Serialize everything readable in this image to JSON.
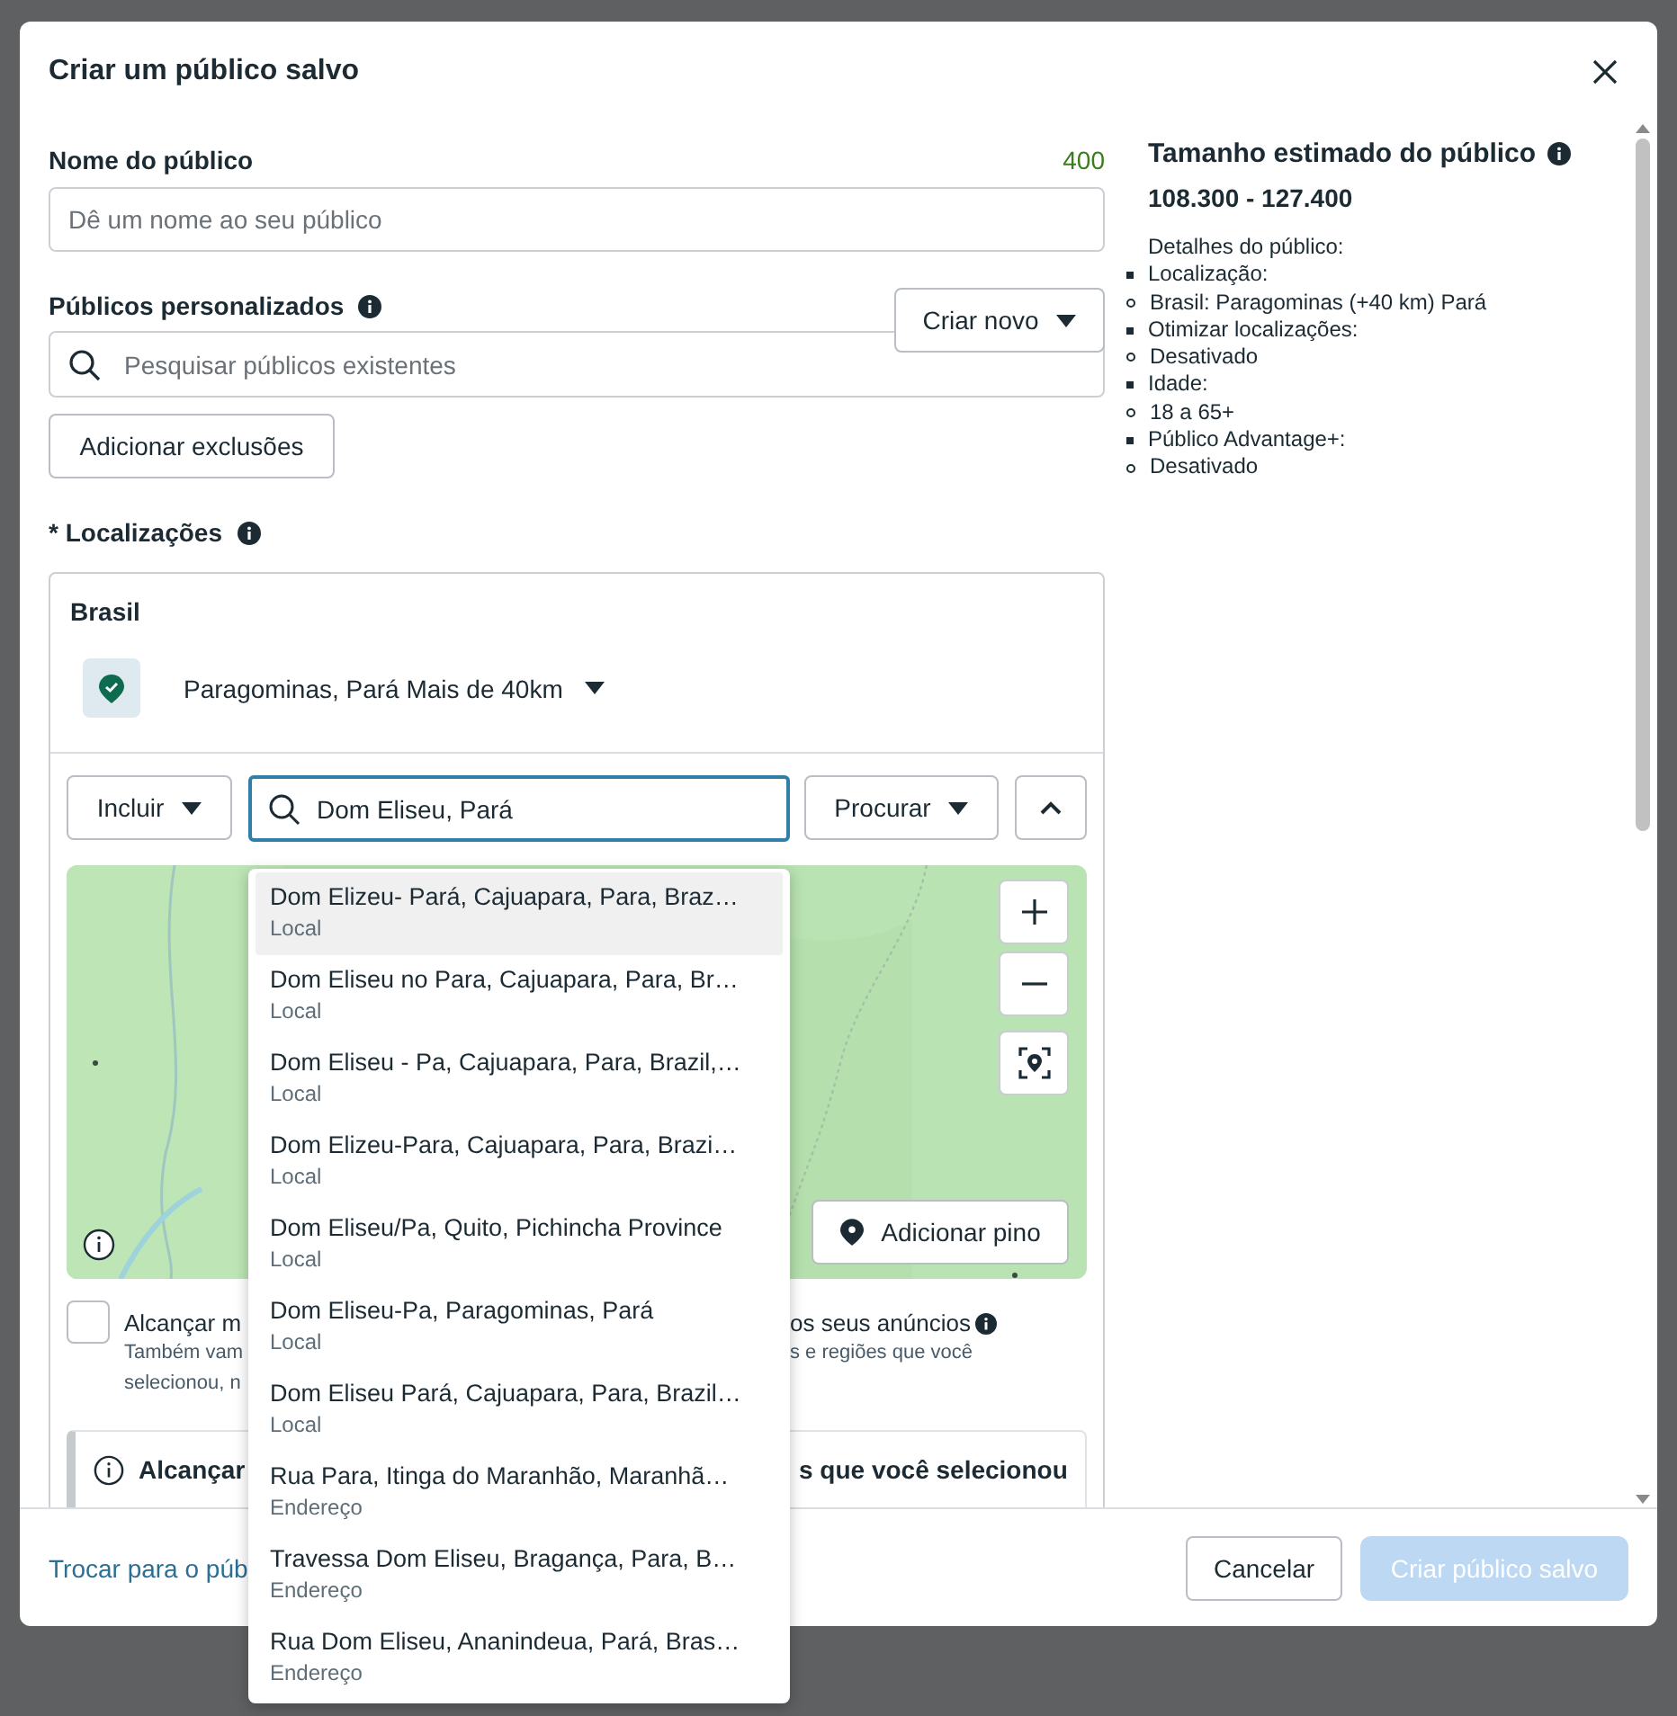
{
  "dialog": {
    "title": "Criar um público salvo"
  },
  "audience_name": {
    "label": "Nome do público",
    "char_count": "400",
    "placeholder": "Dê um nome ao seu público"
  },
  "custom_audiences": {
    "label": "Públicos personalizados",
    "search_placeholder": "Pesquisar públicos existentes",
    "create_button": "Criar novo",
    "exclusions_button": "Adicionar exclusões"
  },
  "locations": {
    "label": "* Localizações",
    "country": "Brasil",
    "selected_location": "Paragominas, Pará Mais de 40km",
    "include_dropdown": "Incluir",
    "search_value": "Dom Eliseu, Pará",
    "search_mode_dropdown": "Procurar",
    "add_pin_button": "Adicionar pino",
    "expand_checkbox": {
      "checked": false,
      "label_fragments": [
        "Alcançar m",
        "os seus anúncios"
      ],
      "note_lines": [
        [
          "Também vam",
          "s e regiões que você"
        ],
        [
          "selecionou, n"
        ]
      ]
    },
    "notice": {
      "title_fragments": [
        "Alcançar",
        "s que você selecionou"
      ]
    }
  },
  "suggestions": [
    {
      "name": "Dom Elizeu- Pará, Cajuapara, Para, Braz…",
      "type": "Local",
      "selected": true
    },
    {
      "name": "Dom Eliseu no Para, Cajuapara, Para, Br…",
      "type": "Local",
      "selected": false
    },
    {
      "name": "Dom Eliseu - Pa, Cajuapara, Para, Brazil,…",
      "type": "Local",
      "selected": false
    },
    {
      "name": "Dom Elizeu-Para, Cajuapara, Para, Brazi…",
      "type": "Local",
      "selected": false
    },
    {
      "name": "Dom Eliseu/Pa, Quito, Pichincha Province",
      "type": "Local",
      "selected": false
    },
    {
      "name": "Dom Eliseu-Pa, Paragominas, Pará",
      "type": "Local",
      "selected": false
    },
    {
      "name": "Dom Eliseu Pará, Cajuapara, Para, Brazil…",
      "type": "Local",
      "selected": false
    },
    {
      "name": "Rua Para, Itinga do Maranhão, Maranhã…",
      "type": "Endereço",
      "selected": false
    },
    {
      "name": "Travessa Dom Eliseu, Bragança, Para, B…",
      "type": "Endereço",
      "selected": false
    },
    {
      "name": "Rua Dom Eliseu, Ananindeua, Pará, Bras…",
      "type": "Endereço",
      "selected": false
    }
  ],
  "estimate": {
    "title": "Tamanho estimado do público",
    "range": "108.300 - 127.400",
    "details_heading": "Detalhes do público:",
    "details": [
      {
        "label": "Localização:",
        "children": [
          {
            "label": "Brasil: Paragominas (+40 km) Pará"
          }
        ]
      },
      {
        "label": "Otimizar localizações:",
        "children": [
          {
            "label": "Desativado"
          }
        ]
      },
      {
        "label": "Idade:",
        "children": [
          {
            "label": "18 a 65+"
          }
        ]
      },
      {
        "label": "Público Advantage+:",
        "children": [
          {
            "label": "Desativado"
          }
        ]
      }
    ]
  },
  "footer": {
    "switch_link": "Trocar para o púb",
    "cancel_button": "Cancelar",
    "save_button": {
      "label": "Criar público salvo",
      "disabled": true
    }
  }
}
